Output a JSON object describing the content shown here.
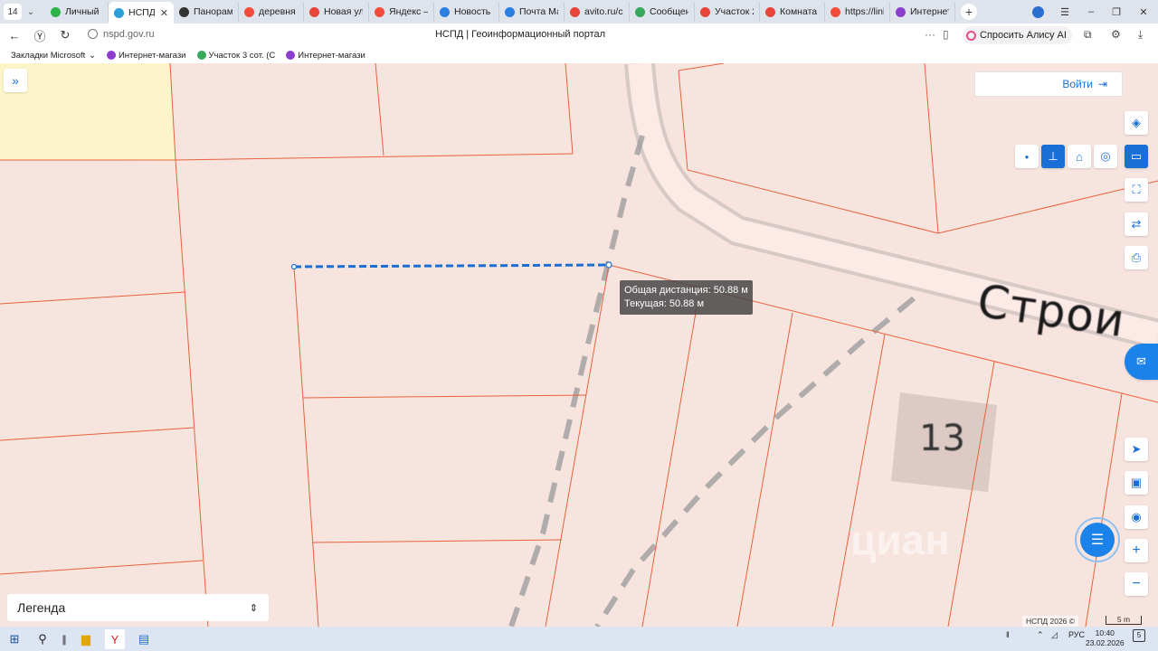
{
  "browser": {
    "tab_count": "14",
    "tabs": [
      {
        "label": "Личный ка",
        "color": "#2db34a",
        "active": false
      },
      {
        "label": "НСПД |",
        "color": "#2a9fd8",
        "active": true
      },
      {
        "label": "Панорама",
        "color": "#333333",
        "active": false
      },
      {
        "label": "деревня М",
        "color": "#f34b3c",
        "active": false
      },
      {
        "label": "Новая ули",
        "color": "#e8453c",
        "active": false
      },
      {
        "label": "Яндекс — (",
        "color": "#f34b3c",
        "active": false
      },
      {
        "label": "Новость",
        "color": "#2a7de1",
        "active": false
      },
      {
        "label": "Почта Ма",
        "color": "#2a7de1",
        "active": false
      },
      {
        "label": "avito.ru/ch",
        "color": "#e8453c",
        "active": false
      },
      {
        "label": "Сообщени",
        "color": "#38a85c",
        "active": false
      },
      {
        "label": "Участок 20",
        "color": "#e8453c",
        "active": false
      },
      {
        "label": "Комната 1",
        "color": "#e8453c",
        "active": false
      },
      {
        "label": "https://link",
        "color": "#f34b3c",
        "active": false
      },
      {
        "label": "Интернет-",
        "color": "#8c3fcf",
        "active": false
      }
    ],
    "url": "nspd.gov.ru",
    "page_title": "НСПД | Геоинформационный портал",
    "alice_label": "Спросить Алису AI",
    "bookmarks": [
      {
        "label": "Закладки Microsoft",
        "color": ""
      },
      {
        "label": "Интернет-магази",
        "color": "#8c3fcf"
      },
      {
        "label": "Участок 3 сот. (С",
        "color": "#38a85c"
      },
      {
        "label": "Интернет-магази",
        "color": "#8c3fcf"
      }
    ]
  },
  "map": {
    "login_label": "Войти",
    "street_label": "Строи",
    "house_number": "13",
    "measure": {
      "total": "Общая дистанция: 50.88 м",
      "current": "Текущая: 50.88 м"
    },
    "legend_label": "Легенда",
    "copyright": "НСПД 2026 ©",
    "scale": "5 m",
    "watermark": "циан",
    "colors": {
      "parcel_line": "#e8623d",
      "measure_line": "#1a6fd6",
      "highlight_parcel": "#fbf5c9",
      "accent": "#1a6fd6"
    }
  },
  "taskbar": {
    "lang": "РУС",
    "time": "10:40",
    "date": "23.02.2026",
    "notifications": "5"
  }
}
